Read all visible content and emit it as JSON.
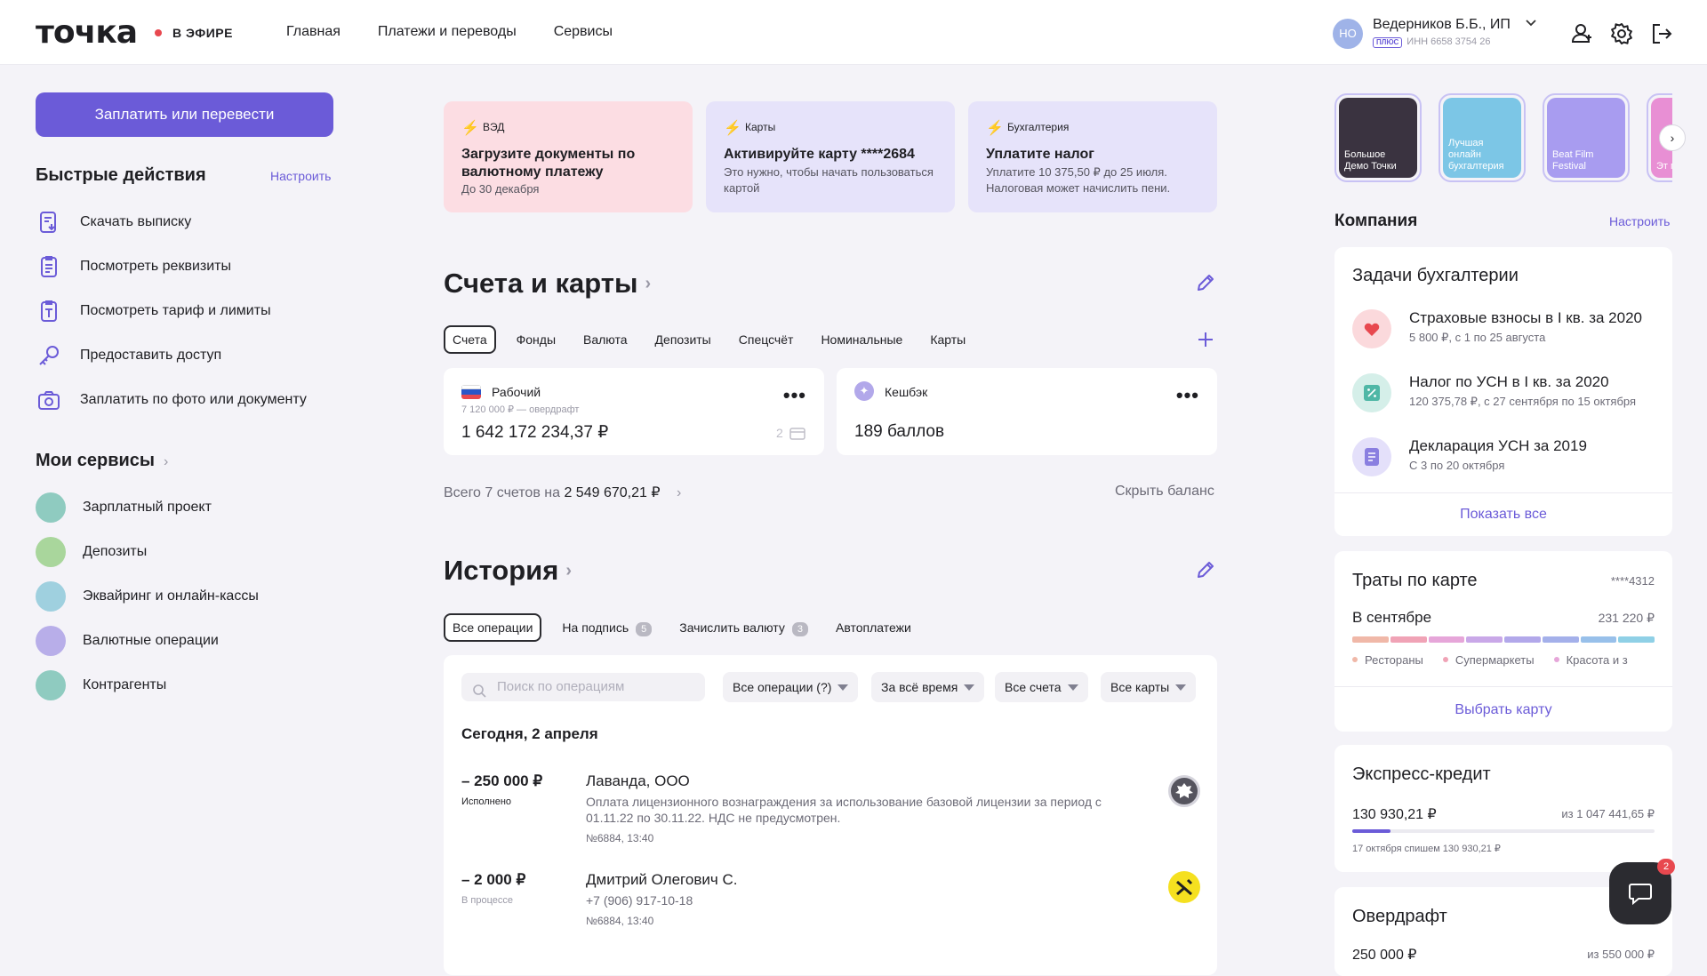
{
  "brand": {
    "logo": "точка",
    "live": "В ЭФИРЕ"
  },
  "nav": {
    "items": [
      "Главная",
      "Платежи и переводы",
      "Сервисы"
    ]
  },
  "user": {
    "initials": "НО",
    "name": "Ведерников Б.Б., ИП",
    "plan": "ПЛЮС",
    "inn": "ИНН 6658 3754 26"
  },
  "left": {
    "pay_button": "Заплатить или перевести",
    "quick_title": "Быстрые действия",
    "quick_setup": "Настроить",
    "quick_actions": [
      {
        "label": "Скачать выписку",
        "icon": "statement-download-icon"
      },
      {
        "label": "Посмотреть реквизиты",
        "icon": "requisites-icon"
      },
      {
        "label": "Посмотреть тариф и лимиты",
        "icon": "tariff-icon"
      },
      {
        "label": "Предоставить доступ",
        "icon": "key-icon"
      },
      {
        "label": "Заплатить по фото или документу",
        "icon": "camera-icon"
      }
    ],
    "services_title": "Мои сервисы",
    "services": [
      {
        "label": "Зарплатный проект",
        "color": "#8fcbc0"
      },
      {
        "label": "Депозиты",
        "color": "#a9d69c"
      },
      {
        "label": "Эквайринг и онлайн-кассы",
        "color": "#9fd0df"
      },
      {
        "label": "Валютные операции",
        "color": "#b8aee9"
      },
      {
        "label": "Контрагенты",
        "color": "#8fcbc0"
      }
    ]
  },
  "promos": [
    {
      "category": "ВЭД",
      "title": "Загрузите документы по валютному платежу",
      "desc": "До 30 декабря",
      "bg": "#fcdde3",
      "accent": "#e8484f"
    },
    {
      "category": "Карты",
      "title": "Активируйте карту ****2684",
      "desc": "Это нужно, чтобы начать пользоваться картой",
      "bg": "#e6e3fa",
      "accent": "#8a7fe0"
    },
    {
      "category": "Бухгалтерия",
      "title": "Уплатите налог",
      "desc": "Уплатите 10 375,50 ₽ до 25 июля. Налоговая может начислить пени.",
      "bg": "#e6e3fa",
      "accent": "#8a7fe0"
    }
  ],
  "accounts": {
    "title": "Счета и карты",
    "tabs": [
      "Счета",
      "Фонды",
      "Валюта",
      "Депозиты",
      "Спецсчёт",
      "Номинальные",
      "Карты"
    ],
    "cards": [
      {
        "name": "Рабочий",
        "sub": "7 120 000 ₽ — овердрафт",
        "balance": "1 642 172 234,37 ₽",
        "cards_count": "2"
      },
      {
        "name": "Кешбэк",
        "balance": "189 баллов"
      }
    ],
    "total_prefix": "Всего 7 счетов на",
    "total_value": "2 549 670,21 ₽",
    "hide_balance": "Скрыть баланс"
  },
  "history": {
    "title": "История",
    "tabs": [
      {
        "label": "Все операции",
        "count": ""
      },
      {
        "label": "На подпись",
        "count": "5"
      },
      {
        "label": "Зачислить валюту",
        "count": "3"
      },
      {
        "label": "Автоплатежи",
        "count": ""
      }
    ],
    "search_placeholder": "Поиск по операциям",
    "filters": [
      "Все операции (?)",
      "За всё время",
      "Все счета",
      "Все карты"
    ],
    "date": "Сегодня, 2 апреля",
    "operations": [
      {
        "amount": "– 250 000 ₽",
        "status": "Исполнено",
        "who": "Лаванда, ООО",
        "desc": "Оплата лицензионного вознаграждения за использование базовой лицензии за период с 01.11.22 по 30.11.22. НДС не предусмотрен.",
        "meta": "№6884, 13:40"
      },
      {
        "amount": "– 2 000 ₽",
        "status": "В процессе",
        "who": "Дмитрий Олегович С.",
        "desc": "+7 (906) 917-10-18",
        "meta": "№6884, 13:40"
      }
    ]
  },
  "stories": [
    {
      "label": "Большое Демо Точки",
      "bg": "#3a3340"
    },
    {
      "label": "Лучшая онлайн бухгалтерия",
      "bg": "#7cc6e6"
    },
    {
      "label": "Beat Film Festival",
      "bg": "#a89cf0"
    },
    {
      "label": "Эт пр",
      "bg": "#e88fd4"
    }
  ],
  "company": {
    "title": "Компания",
    "setup": "Настроить",
    "tasks_title": "Задачи бухгалтерии",
    "tasks": [
      {
        "name": "Страховые взносы в I кв. за 2020",
        "desc": "5 800 ₽, с 1 по 25 августа",
        "color": "#e8484f",
        "bg": "#fbd9dc",
        "icon": "heart-icon"
      },
      {
        "name": "Налог по УСН в I кв. за 2020",
        "desc": "120 375,78 ₽, с 27 сентября по 15 октября",
        "color": "#4fb7a6",
        "bg": "#d5efe9",
        "icon": "percent-icon"
      },
      {
        "name": "Декларация УСН за 2019",
        "desc": "С 3 по 20 октября",
        "color": "#8a7fe0",
        "bg": "#e4e0fa",
        "icon": "document-icon"
      }
    ],
    "show_all": "Показать все"
  },
  "spend": {
    "title": "Траты по карте",
    "card": "****4312",
    "month": "В сентябре",
    "amount": "231 220 ₽",
    "bar_colors": [
      "#f0b8a8",
      "#f0a3b6",
      "#e6a6d9",
      "#c9a8e8",
      "#b2a8ea",
      "#a4b0ea",
      "#98c0ea",
      "#8fd0e6"
    ],
    "legend": [
      {
        "label": "Рестораны",
        "color": "#f0b8a8"
      },
      {
        "label": "Супермаркеты",
        "color": "#f0a3b6"
      },
      {
        "label": "Красота и з",
        "color": "#e6a6d9"
      }
    ],
    "choose": "Выбрать карту"
  },
  "credit": {
    "title": "Экспресс-кредит",
    "used": "130 930,21 ₽",
    "limit": "из 1 047 441,65 ₽",
    "progress": 0.125,
    "note": "17 октября спишем 130 930,21 ₽"
  },
  "overdraft": {
    "title": "Овердрафт",
    "used": "250 000 ₽",
    "limit": "из 550 000 ₽"
  },
  "chat": {
    "badge": "2"
  }
}
